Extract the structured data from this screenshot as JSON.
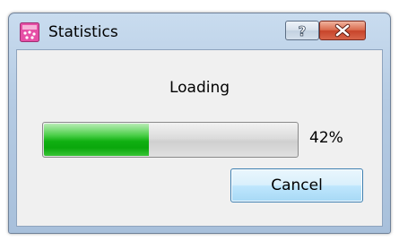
{
  "window": {
    "title": "Statistics",
    "icon": "statistics-app-icon",
    "help_icon": "question-mark-icon",
    "close_icon": "close-x-icon"
  },
  "dialog": {
    "status_text": "Loading",
    "progress": {
      "value": 42,
      "label": "42%",
      "fill_color": "#10b012"
    },
    "cancel_label": "Cancel"
  }
}
